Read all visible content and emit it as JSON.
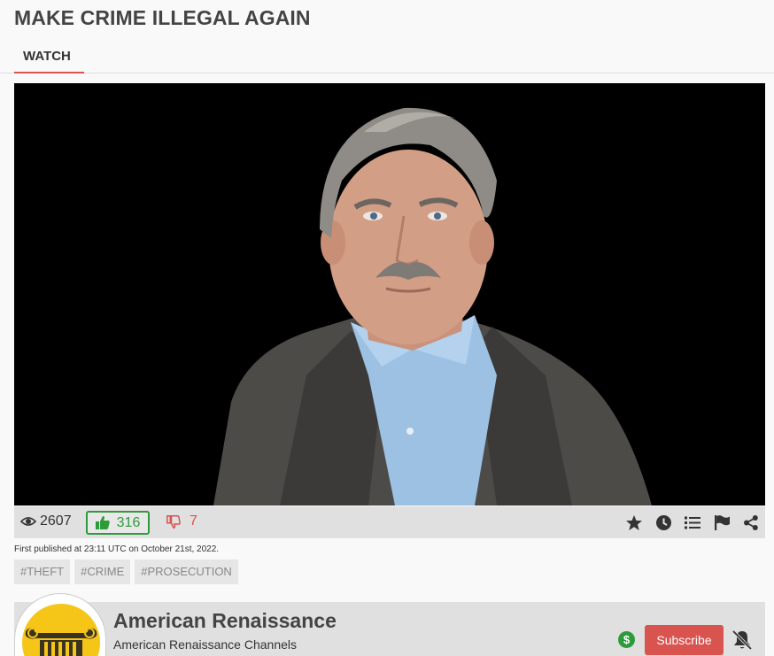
{
  "page": {
    "title": "MAKE CRIME ILLEGAL AGAIN"
  },
  "tabs": [
    {
      "label": "WATCH",
      "active": true
    }
  ],
  "stats": {
    "views": "2607",
    "likes": "316",
    "dislikes": "7"
  },
  "actions": {
    "icons": [
      "star-icon",
      "clock-icon",
      "list-icon",
      "flag-icon",
      "share-icon"
    ]
  },
  "published": "First published at 23:11 UTC on October 21st, 2022.",
  "tags": [
    "#THEFT",
    "#CRIME",
    "#PROSECUTION"
  ],
  "channel": {
    "name": "American Renaissance",
    "subtitle": "American Renaissance Channels",
    "donate_symbol": "$",
    "subscribe_label": "Subscribe"
  },
  "colors": {
    "accent_red": "#d9534f",
    "like_green": "#2e9b3b",
    "bar_gray": "#e0e0e0",
    "logo_yellow": "#f5c518"
  }
}
